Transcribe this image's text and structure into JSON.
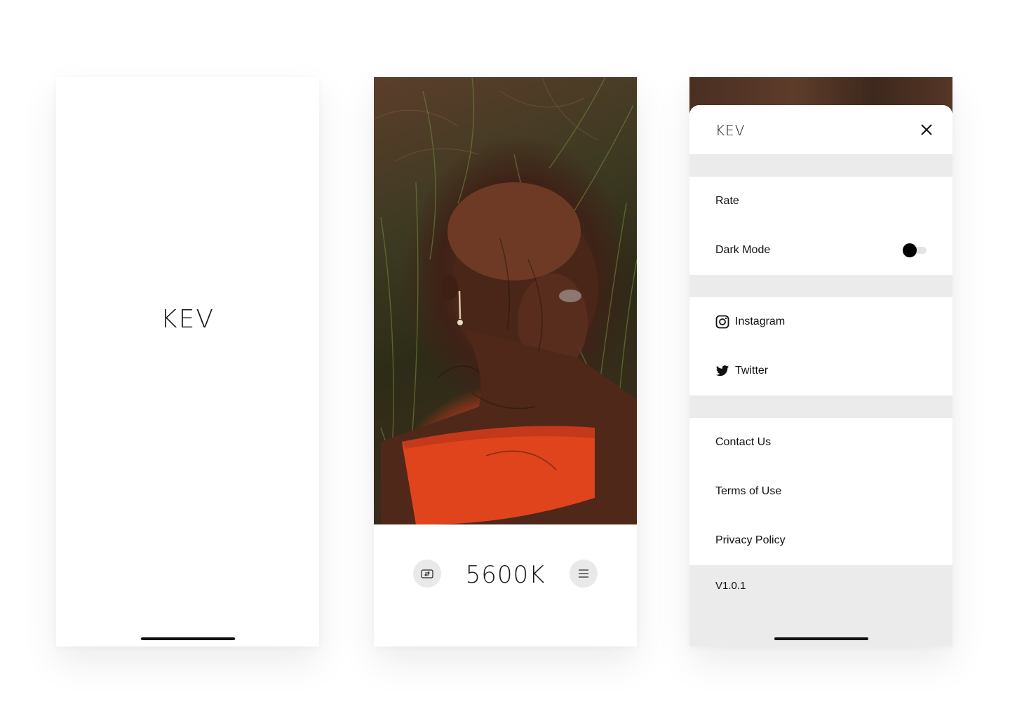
{
  "splash": {
    "logo": "KEV"
  },
  "camera": {
    "temperature": "5600K",
    "switch_icon": "camera-switch-icon",
    "menu_icon": "hamburger-menu-icon"
  },
  "menu": {
    "title": "KEV",
    "close_icon": "close-icon",
    "sections": [
      {
        "items": [
          {
            "label": "Rate"
          },
          {
            "label": "Dark Mode",
            "toggle": false
          }
        ]
      },
      {
        "items": [
          {
            "label": "Instagram",
            "icon": "instagram-icon"
          },
          {
            "label": "Twitter",
            "icon": "twitter-icon"
          }
        ]
      },
      {
        "items": [
          {
            "label": "Contact Us"
          },
          {
            "label": "Terms of Use"
          },
          {
            "label": "Privacy Policy"
          }
        ]
      }
    ],
    "version": "V1.0.1"
  },
  "colors": {
    "background": "#ffffff",
    "section_gap": "#ebebeb",
    "text": "#111111",
    "button_bg": "#e9e9e9",
    "photo_accent": "#e8441c"
  }
}
